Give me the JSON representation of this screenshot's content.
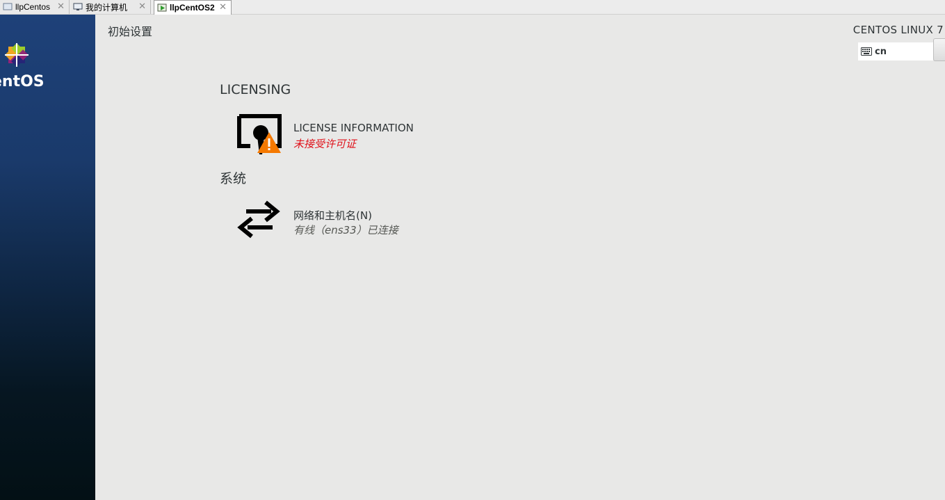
{
  "vm_tabs": [
    {
      "label": "llpCentos",
      "icon": "vm-icon",
      "active": false
    },
    {
      "label": "我的计算机",
      "icon": "computer-icon",
      "active": false
    },
    {
      "label": "llpCentOS2",
      "icon": "vm-running-icon",
      "active": true
    }
  ],
  "tab_close_glyph": "✕",
  "sidebar": {
    "logo_text": "entOS",
    "logo_icon": "centos-logo-icon"
  },
  "header": {
    "title": "初始设置",
    "product": "CENTOS LINUX 7",
    "keyboard_layout": "cn",
    "keyboard_icon": "keyboard-icon"
  },
  "sections": [
    {
      "title": "LICENSING",
      "spokes": [
        {
          "title": "LICENSE INFORMATION",
          "status": "未接受许可证",
          "status_kind": "warning",
          "icon": "license-warning-icon"
        }
      ]
    },
    {
      "title": "系统",
      "spokes": [
        {
          "title": "网络和主机名(N)",
          "status": "有线（ens33）已连接",
          "status_kind": "ok",
          "icon": "network-arrows-icon"
        }
      ]
    }
  ],
  "colors": {
    "background": "#e8e8e7",
    "sidebar_top": "#1e4179",
    "sidebar_bottom": "#031015",
    "warning_text": "#e0111a",
    "warning_badge": "#f57900",
    "text": "#2e3436"
  }
}
